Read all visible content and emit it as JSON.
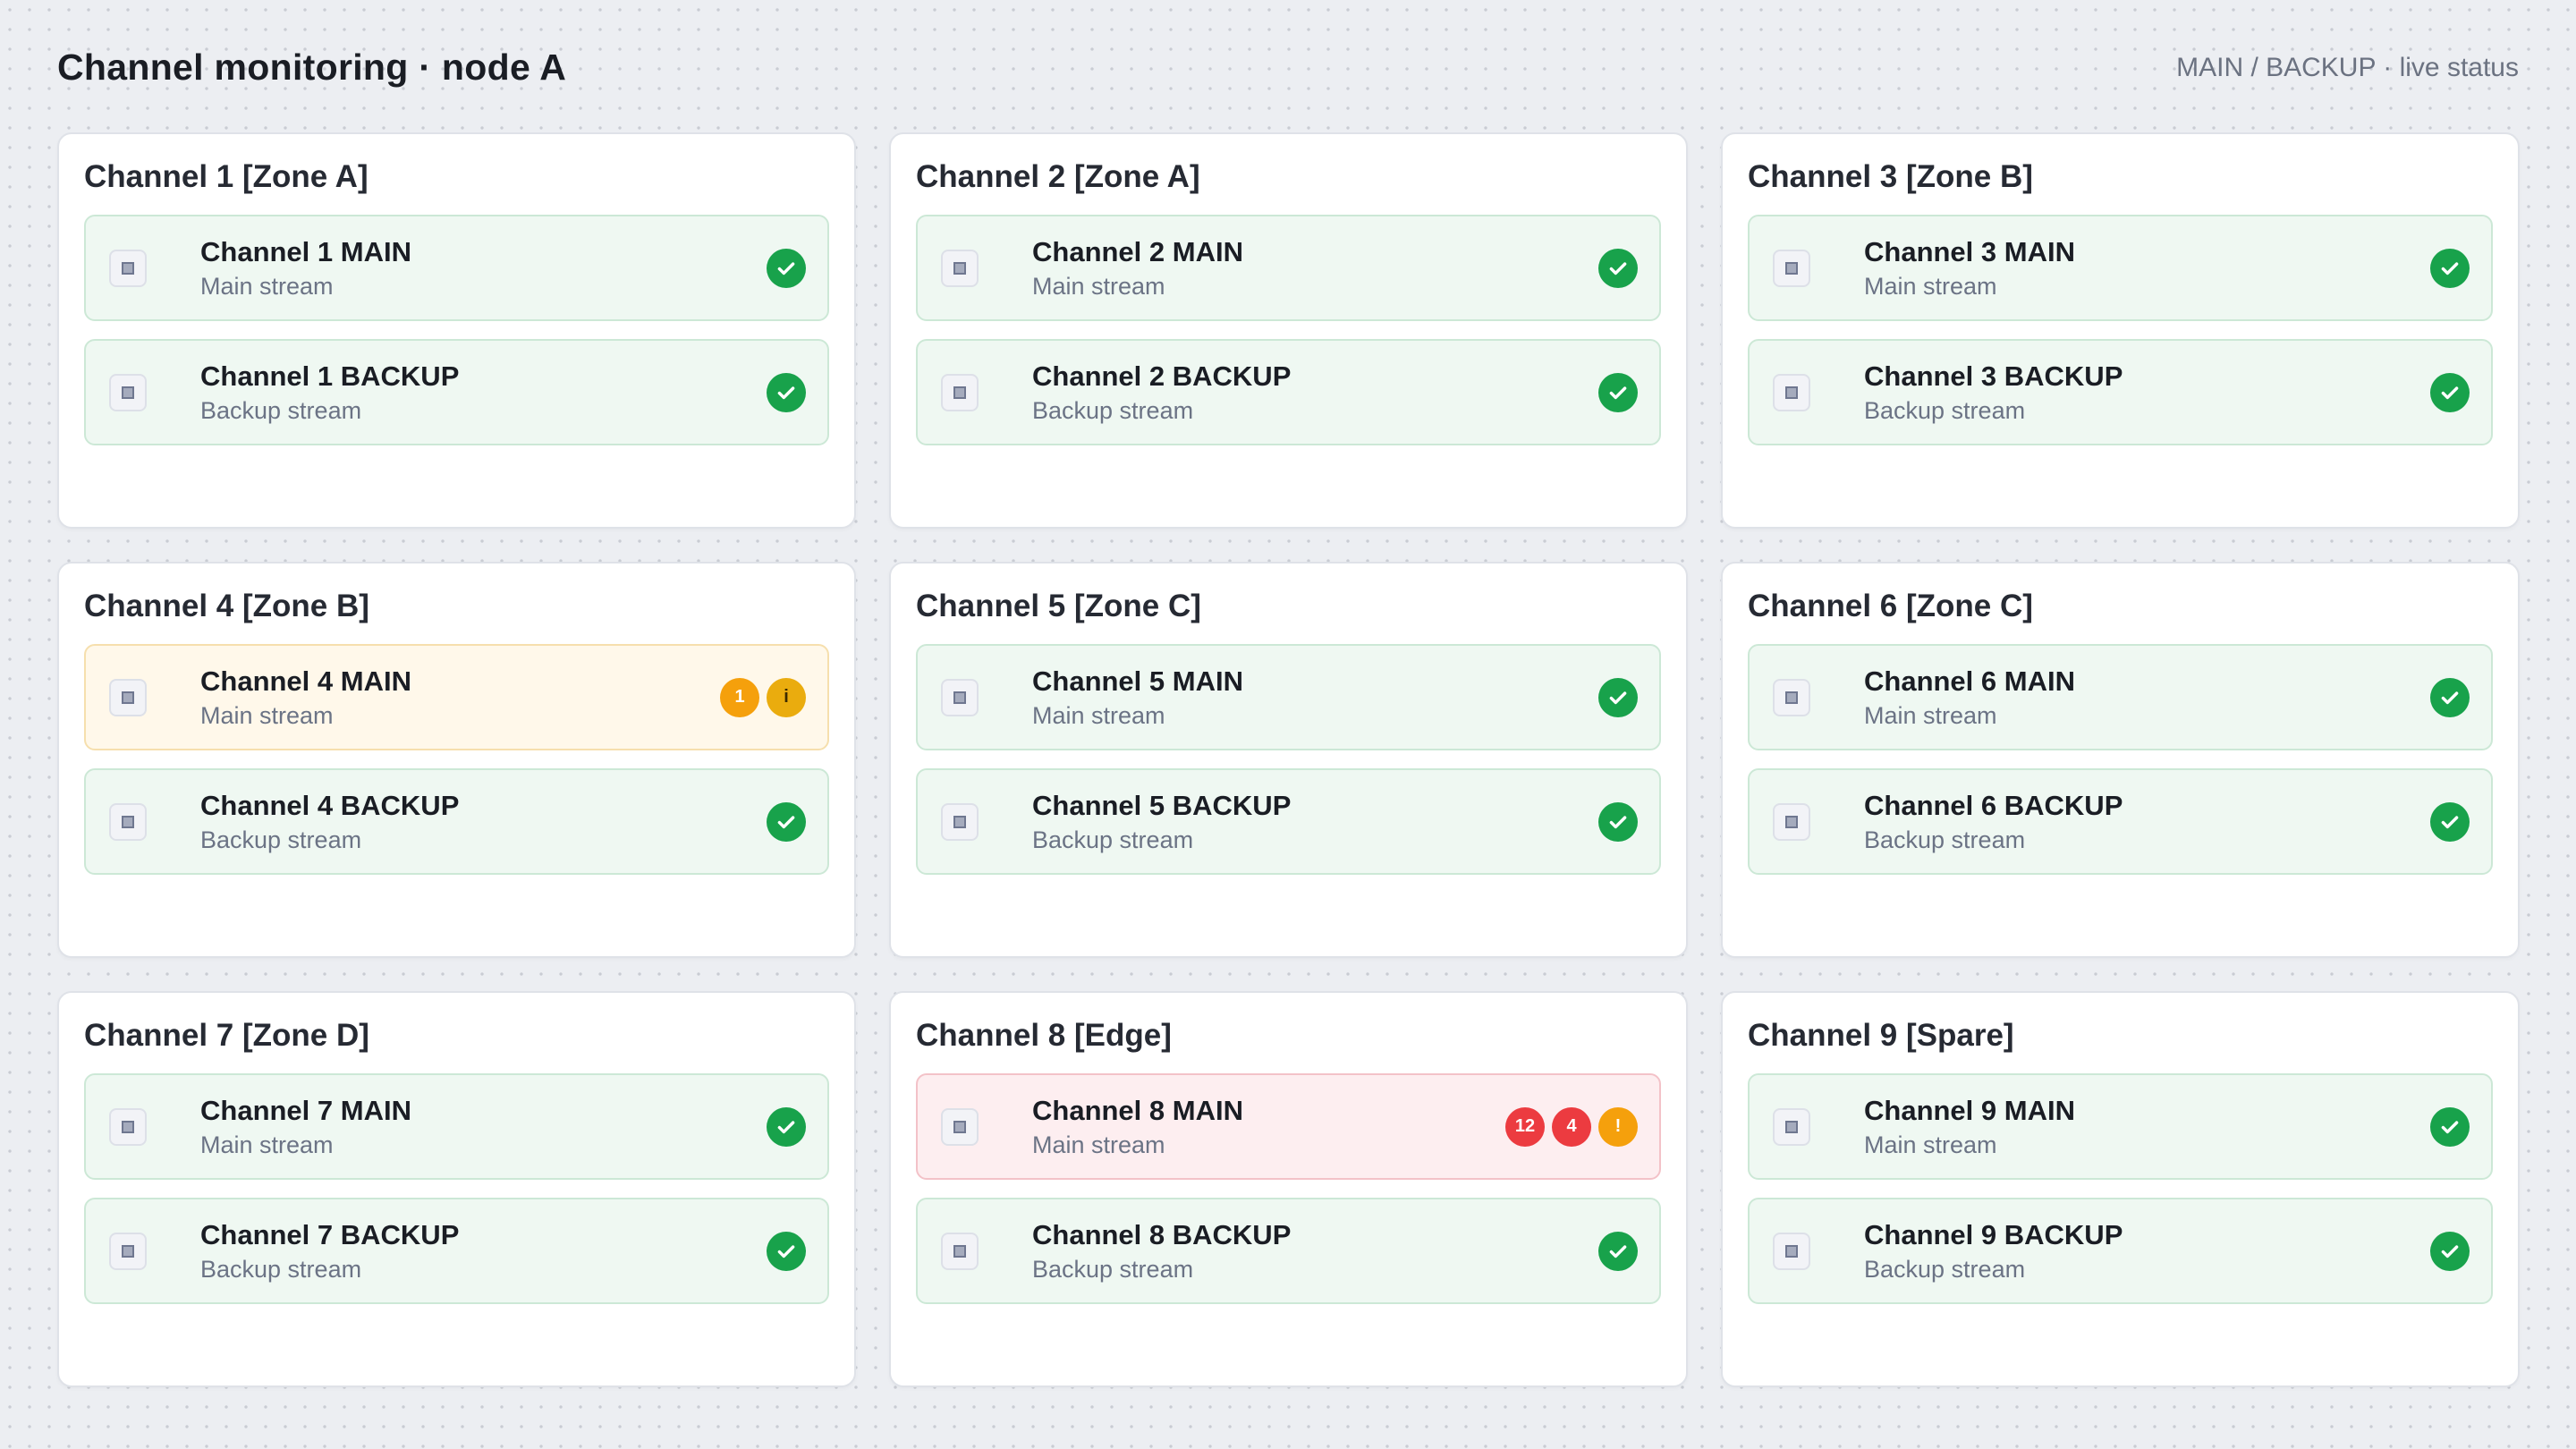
{
  "header": {
    "title": "Channel monitoring · node A",
    "subtitle": "MAIN / BACKUP · live status"
  },
  "colors": {
    "ok": "#18a24b",
    "warning": "#f5a00c",
    "info": "#eaac0e",
    "error": "#ec3b40"
  },
  "icons": {
    "stream": "stream-square-icon",
    "ok": "check-circle-icon"
  },
  "channels": [
    {
      "title": "Channel 1 [Zone A]",
      "main": {
        "name": "Channel 1 MAIN",
        "desc": "Main stream",
        "status": "ok"
      },
      "backup": {
        "name": "Channel 1 BACKUP",
        "desc": "Backup stream",
        "status": "ok"
      }
    },
    {
      "title": "Channel 2 [Zone A]",
      "main": {
        "name": "Channel 2 MAIN",
        "desc": "Main stream",
        "status": "ok"
      },
      "backup": {
        "name": "Channel 2 BACKUP",
        "desc": "Backup stream",
        "status": "ok"
      }
    },
    {
      "title": "Channel 3 [Zone B]",
      "main": {
        "name": "Channel 3 MAIN",
        "desc": "Main stream",
        "status": "ok"
      },
      "backup": {
        "name": "Channel 3 BACKUP",
        "desc": "Backup stream",
        "status": "ok"
      }
    },
    {
      "title": "Channel 4 [Zone B]",
      "main": {
        "name": "Channel 4 MAIN",
        "desc": "Main stream",
        "status": "warn",
        "warn_count": "1",
        "info_glyph": "i"
      },
      "backup": {
        "name": "Channel 4 BACKUP",
        "desc": "Backup stream",
        "status": "ok"
      }
    },
    {
      "title": "Channel 5 [Zone C]",
      "main": {
        "name": "Channel 5 MAIN",
        "desc": "Main stream",
        "status": "ok"
      },
      "backup": {
        "name": "Channel 5 BACKUP",
        "desc": "Backup stream",
        "status": "ok"
      }
    },
    {
      "title": "Channel 6 [Zone C]",
      "main": {
        "name": "Channel 6 MAIN",
        "desc": "Main stream",
        "status": "ok"
      },
      "backup": {
        "name": "Channel 6 BACKUP",
        "desc": "Backup stream",
        "status": "ok"
      }
    },
    {
      "title": "Channel 7 [Zone D]",
      "main": {
        "name": "Channel 7 MAIN",
        "desc": "Main stream",
        "status": "ok"
      },
      "backup": {
        "name": "Channel 7 BACKUP",
        "desc": "Backup stream",
        "status": "ok"
      }
    },
    {
      "title": "Channel 8 [Edge]",
      "main": {
        "name": "Channel 8 MAIN",
        "desc": "Main stream",
        "status": "error",
        "error_count": "12",
        "error_count_2": "4",
        "alert_glyph": "!"
      },
      "backup": {
        "name": "Channel 8 BACKUP",
        "desc": "Backup stream",
        "status": "ok"
      }
    },
    {
      "title": "Channel 9 [Spare]",
      "main": {
        "name": "Channel 9 MAIN",
        "desc": "Main stream",
        "status": "ok"
      },
      "backup": {
        "name": "Channel 9 BACKUP",
        "desc": "Backup stream",
        "status": "ok"
      }
    }
  ]
}
